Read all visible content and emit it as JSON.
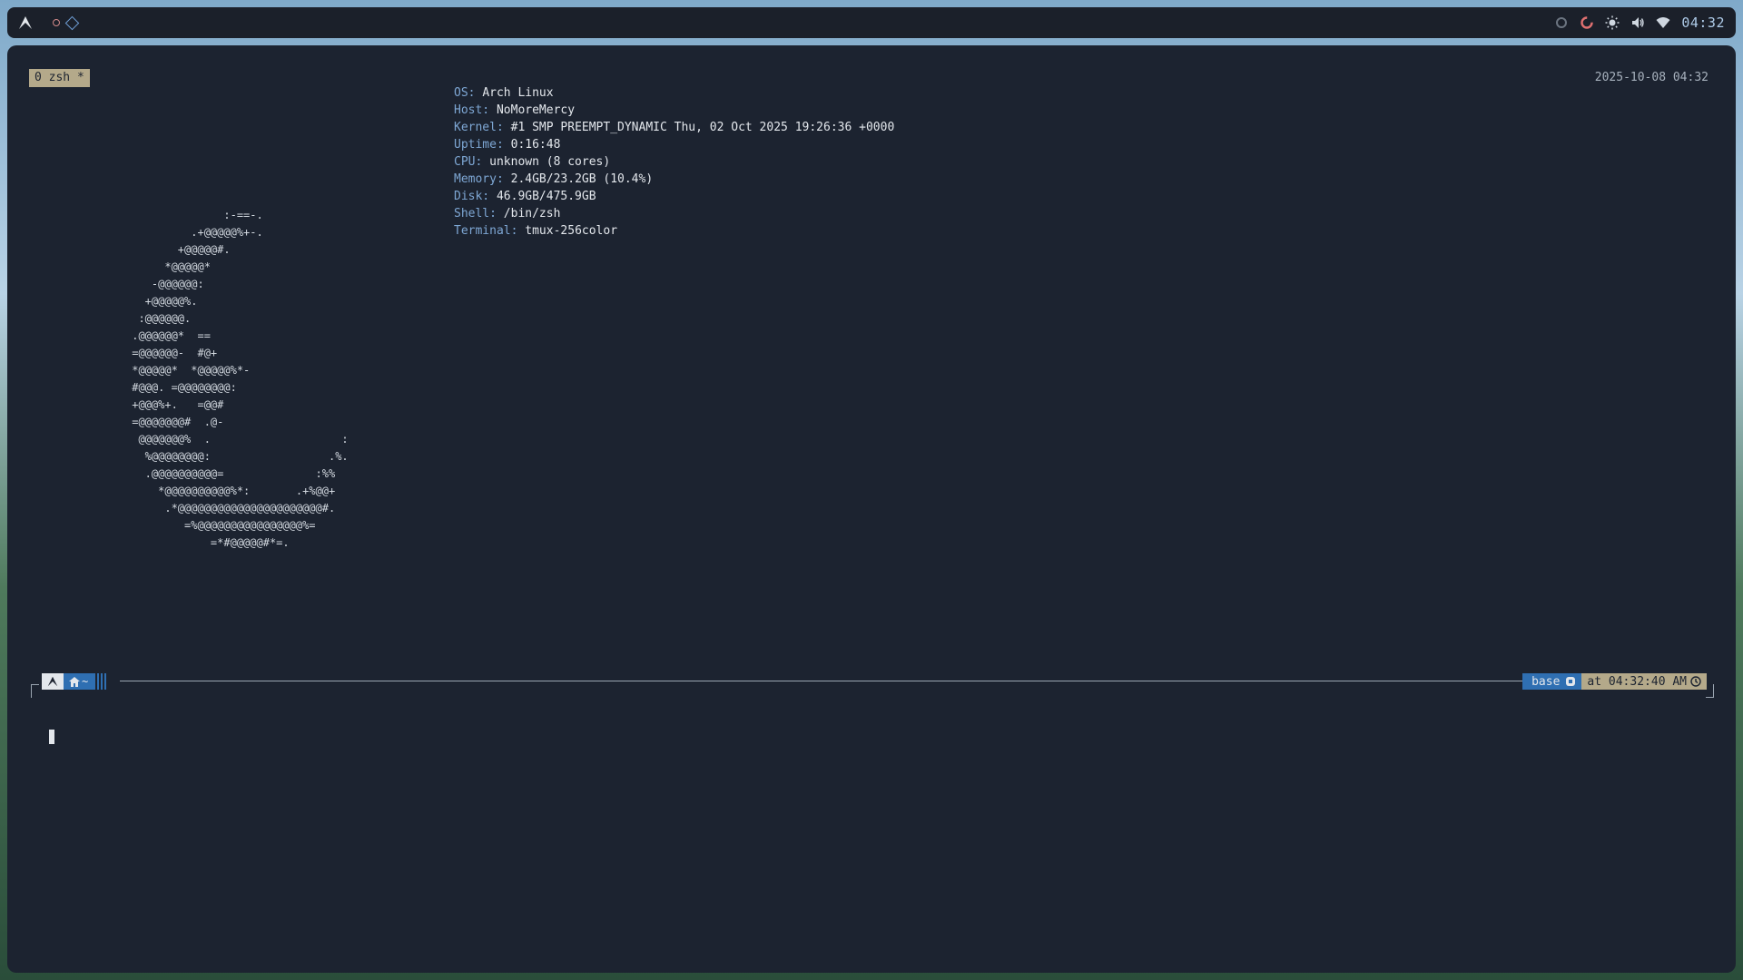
{
  "topbar": {
    "launcher_icon": "arch-logo-icon",
    "workspaces": [
      "workspace-circle-icon",
      "workspace-diamond-icon"
    ],
    "tray_icons": [
      "night-light-icon",
      "record-icon",
      "brightness-icon",
      "volume-icon",
      "wifi-icon"
    ],
    "clock": "04:32"
  },
  "terminal": {
    "tmux": {
      "tab_label": "0 zsh *",
      "datetime": "2025-10-08 04:32"
    },
    "ascii_logo": "               :-==-.\n          .+@@@@@%+-.\n        +@@@@@#.\n      *@@@@@*\n    -@@@@@@:\n   +@@@@@%.\n  :@@@@@@.\n .@@@@@@*  ==\n =@@@@@@-  #@+\n *@@@@@*  *@@@@@%*-\n #@@@. =@@@@@@@@:\n +@@@%+.   =@@#\n =@@@@@@@#  .@-\n  @@@@@@@%  .                    :\n   %@@@@@@@@:                  .%.\n   .@@@@@@@@@@=              :%%\n     *@@@@@@@@@@%*:       .+%@@+\n      .*@@@@@@@@@@@@@@@@@@@@@@#.\n         =%@@@@@@@@@@@@@@@@%=\n             =*#@@@@@#*=.",
    "sysinfo": [
      {
        "key": "OS:",
        "value": "Arch Linux"
      },
      {
        "key": "Host:",
        "value": "NoMoreMercy"
      },
      {
        "key": "Kernel:",
        "value": "#1 SMP PREEMPT_DYNAMIC Thu, 02 Oct 2025 19:26:36 +0000"
      },
      {
        "key": "Uptime:",
        "value": "0:16:48"
      },
      {
        "key": "CPU:",
        "value": "unknown (8 cores)"
      },
      {
        "key": "Memory:",
        "value": "2.4GB/23.2GB (10.4%)"
      },
      {
        "key": "Disk:",
        "value": "46.9GB/475.9GB"
      },
      {
        "key": "Shell:",
        "value": "/bin/zsh"
      },
      {
        "key": "Terminal:",
        "value": "tmux-256color"
      }
    ],
    "prompt": {
      "dir": "~",
      "status_check": "✓",
      "env": "base",
      "time": "at 04:32:40 AM"
    }
  },
  "colors": {
    "bar_bg": "#1b202a",
    "terminal_bg": "#1c2330",
    "accent_blue": "#2f6fb2",
    "key_blue": "#7ea7d4",
    "tmux_tan": "#b4a98a"
  }
}
